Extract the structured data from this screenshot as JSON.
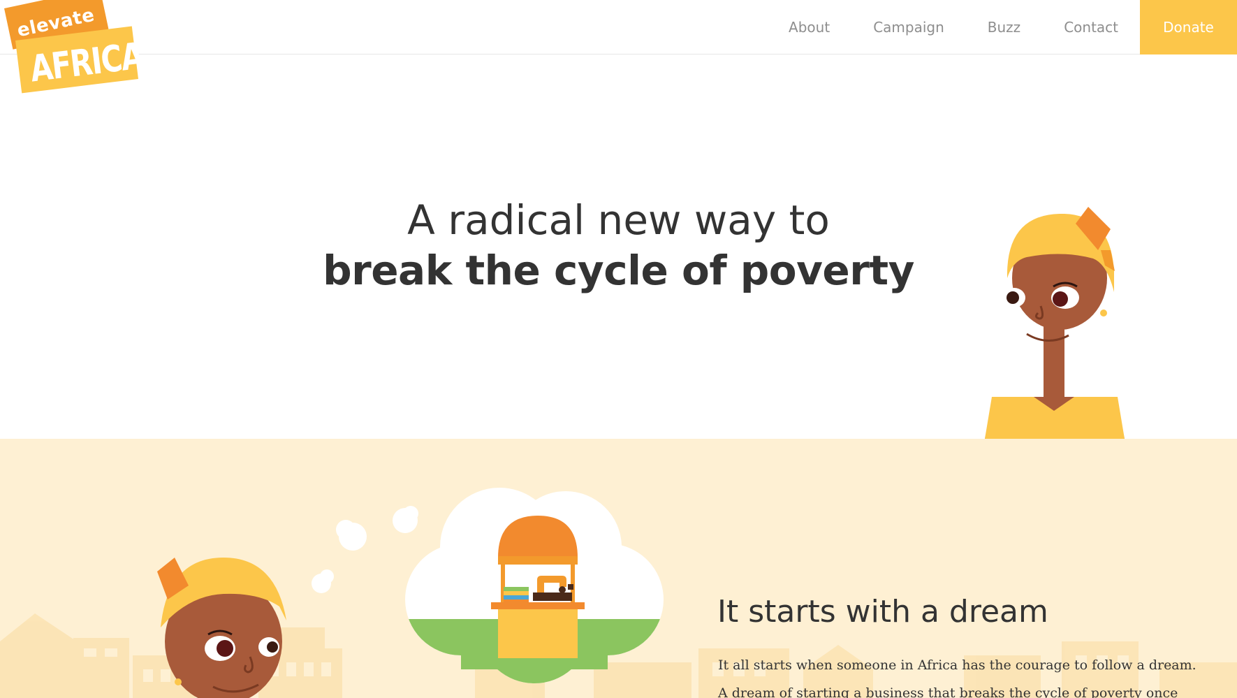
{
  "logo": {
    "top_text": "elevate",
    "bottom_text": "AFRICA"
  },
  "nav": {
    "about": "About",
    "campaign": "Campaign",
    "buzz": "Buzz",
    "contact": "Contact",
    "donate": "Donate"
  },
  "hero": {
    "line1": "A radical new way to",
    "line2": "break the cycle of poverty"
  },
  "dream": {
    "heading": "It starts with a dream",
    "paragraph_line1": "It all starts when someone in Africa has the courage to follow a dream.",
    "paragraph_line2": "A dream of starting a business that breaks the cycle of poverty once"
  },
  "colors": {
    "brand_yellow": "#fcc64a",
    "brand_orange": "#f39a2c",
    "skin": "#a85a3a",
    "section_bg": "#fef0d3",
    "text_dark": "#333333",
    "nav_grey": "#8e8e8e"
  },
  "icons": {
    "hero_illustration": "woman-illustration-icon",
    "dream_illustration": "woman-dreaming-icon",
    "thought_bubbles": "thought-bubbles-icon",
    "dream_cloud": "market-stall-cloud-icon"
  }
}
